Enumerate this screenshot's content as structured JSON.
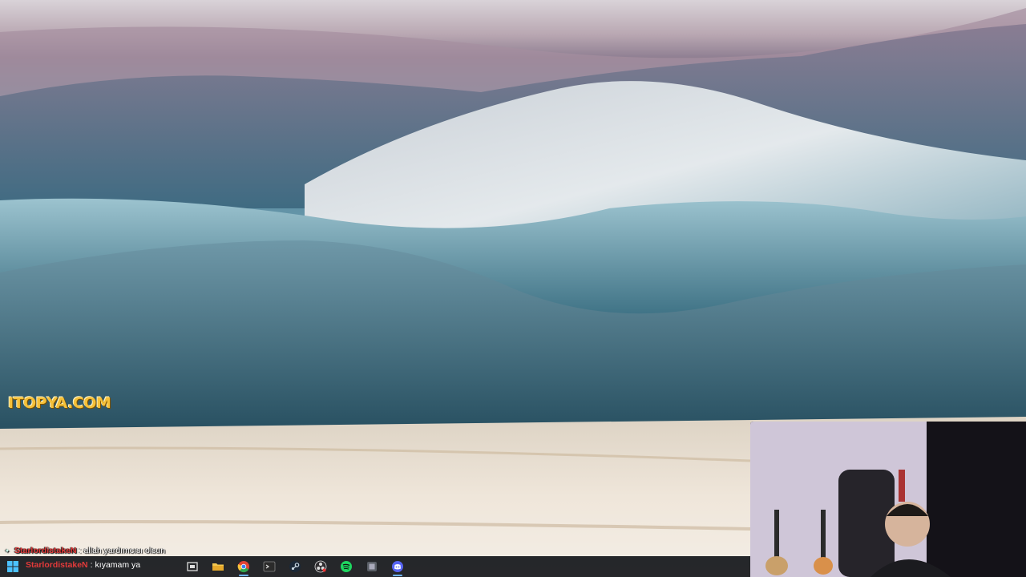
{
  "watermark": {
    "text": "ITOPYA.COM"
  },
  "chat": {
    "messages": [
      {
        "user": "StarlordistakeN",
        "separator": ":",
        "text": "allah yardımcısı olsun"
      },
      {
        "user": "StarlordistakeN",
        "separator": ":",
        "text": "kıyamam ya"
      }
    ]
  },
  "taskbar": {
    "icons": [
      "windows-start-icon",
      "search-icon",
      "task-view-icon",
      "file-explorer-icon",
      "chrome-icon",
      "terminal-icon",
      "steam-icon",
      "obs-icon",
      "spotify-icon",
      "app-icon",
      "discord-icon"
    ]
  },
  "colors": {
    "username": "#e33a3a",
    "watermark": "#f5c13a",
    "taskbar": "#14161a"
  }
}
